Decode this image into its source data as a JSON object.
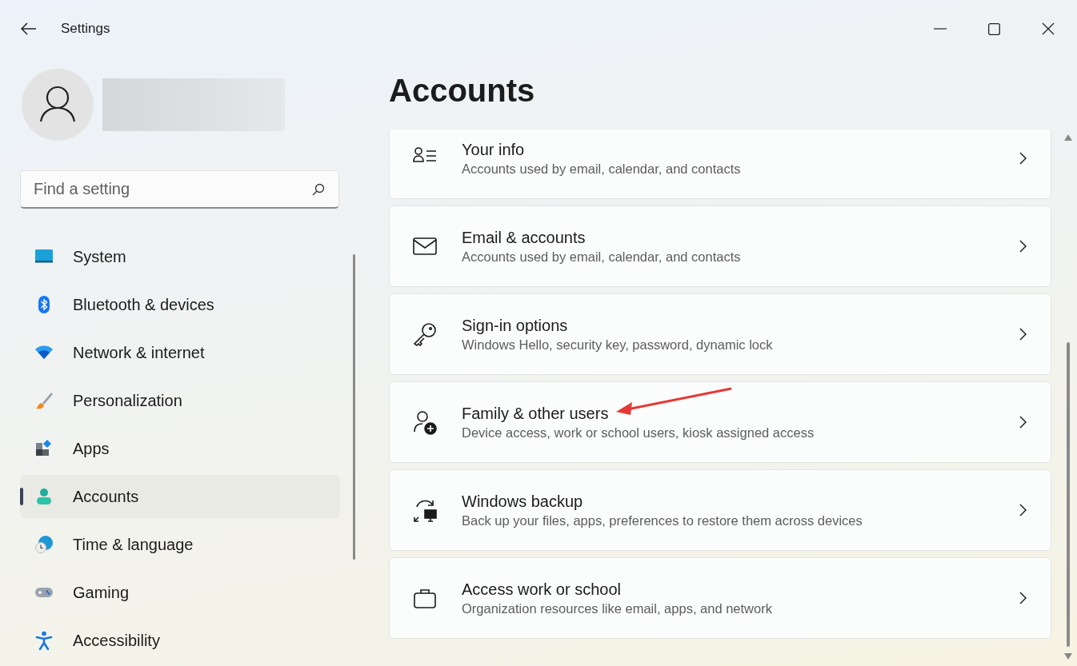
{
  "window": {
    "title": "Settings"
  },
  "search": {
    "placeholder": "Find a setting"
  },
  "sidebar": {
    "items": [
      {
        "label": "System",
        "selected": false
      },
      {
        "label": "Bluetooth & devices",
        "selected": false
      },
      {
        "label": "Network & internet",
        "selected": false
      },
      {
        "label": "Personalization",
        "selected": false
      },
      {
        "label": "Apps",
        "selected": false
      },
      {
        "label": "Accounts",
        "selected": true
      },
      {
        "label": "Time & language",
        "selected": false
      },
      {
        "label": "Gaming",
        "selected": false
      },
      {
        "label": "Accessibility",
        "selected": false
      }
    ]
  },
  "page": {
    "title": "Accounts",
    "cards": [
      {
        "title": "Your info",
        "description": "Accounts used by email, calendar, and contacts"
      },
      {
        "title": "Email & accounts",
        "description": "Accounts used by email, calendar, and contacts"
      },
      {
        "title": "Sign-in options",
        "description": "Windows Hello, security key, password, dynamic lock"
      },
      {
        "title": "Family & other users",
        "description": "Device access, work or school users, kiosk assigned access"
      },
      {
        "title": "Windows backup",
        "description": "Back up your files, apps, preferences to restore them across devices"
      },
      {
        "title": "Access work or school",
        "description": "Organization resources like email, apps, and network"
      }
    ]
  }
}
